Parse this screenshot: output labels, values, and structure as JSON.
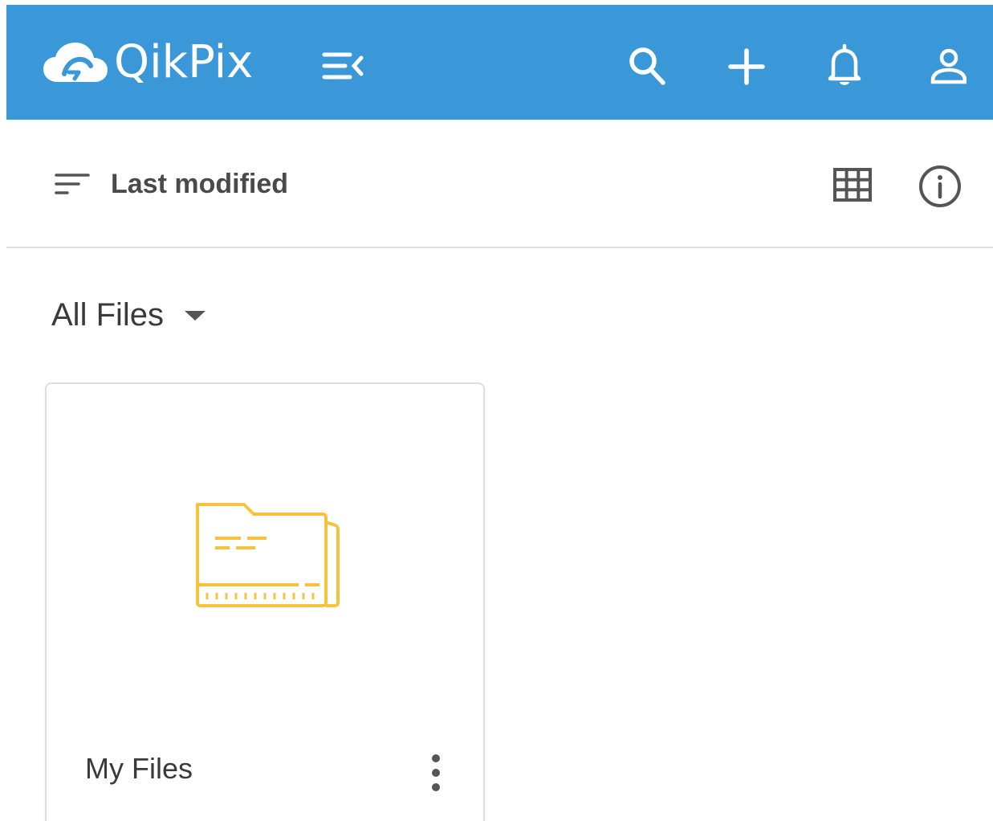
{
  "app": {
    "brand": "QikPix",
    "accent_color": "#3a98d9",
    "header_icons": [
      "logo-cloud-icon",
      "menu-collapse-icon",
      "search-icon",
      "add-icon",
      "bell-icon",
      "user-icon"
    ]
  },
  "toolbar": {
    "sort_label": "Last modified",
    "sort_icon": "sort-icon",
    "view_icon": "grid-view-icon",
    "info_icon": "info-icon"
  },
  "section": {
    "title": "All Files",
    "dropdown_icon": "caret-down-icon"
  },
  "items": [
    {
      "name": "My Files",
      "type_icon": "folder-icon",
      "folder_color": "#f7c33c",
      "menu_icon": "more-vertical-icon"
    }
  ]
}
